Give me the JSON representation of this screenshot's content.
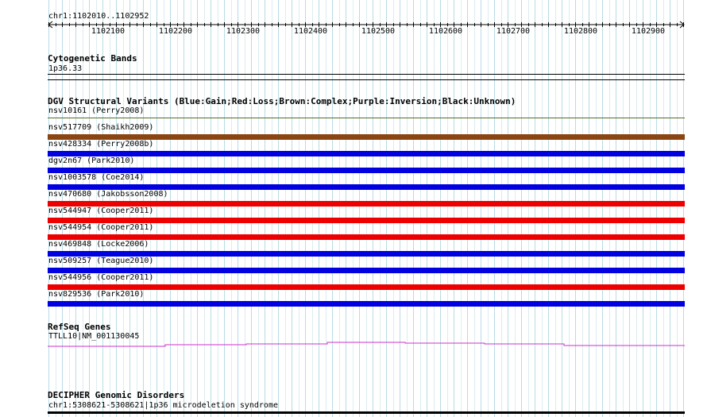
{
  "region": "chr1:1102010..1102952",
  "ruler": {
    "ticks": [
      "1102100",
      "1102200",
      "1102300",
      "1102400",
      "1102500",
      "1102600",
      "1102700",
      "1102800",
      "1102900"
    ]
  },
  "cytoband": {
    "title": "Cytogenetic Bands",
    "band": "1p36.33"
  },
  "dgv": {
    "title": "DGV Structural Variants (Blue:Gain;Red:Loss;Brown:Complex;Purple:Inversion;Black:Unknown)",
    "variants": [
      {
        "label": "nsv10161 (Perry2008)",
        "color": "#556b2f"
      },
      {
        "label": "nsv517709 (Shaikh2009)",
        "color": "#8b4513"
      },
      {
        "label": "nsv428334 (Perry2008b)",
        "color": "#0000e0"
      },
      {
        "label": "dgv2n67 (Park2010)",
        "color": "#0000e0"
      },
      {
        "label": "nsv1003578 (Coe2014)",
        "color": "#0000e0"
      },
      {
        "label": "nsv470680 (Jakobsson2008)",
        "color": "#ee0000"
      },
      {
        "label": "nsv544947 (Cooper2011)",
        "color": "#ee0000"
      },
      {
        "label": "nsv544954 (Cooper2011)",
        "color": "#ee0000"
      },
      {
        "label": "nsv469848 (Locke2006)",
        "color": "#0000e0"
      },
      {
        "label": "nsv509257 (Teague2010)",
        "color": "#0000e0"
      },
      {
        "label": "nsv544956 (Cooper2011)",
        "color": "#ee0000"
      },
      {
        "label": "nsv829536 (Park2010)",
        "color": "#0000e0"
      }
    ]
  },
  "refseq": {
    "title": "RefSeq Genes",
    "gene": "TTLL10|NM_001130045",
    "color": "#cc33cc"
  },
  "decipher": {
    "title": "DECIPHER Genomic Disorders",
    "entry": "chr1:5308621-5308621|1p36 microdeletion syndrome"
  }
}
